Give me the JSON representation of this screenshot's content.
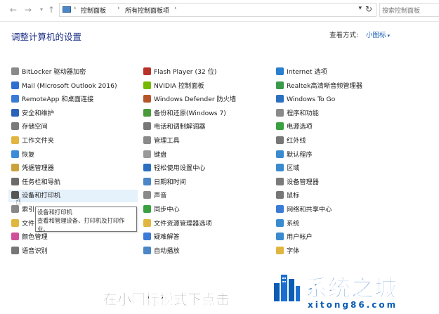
{
  "address_bar": {
    "breadcrumbs": [
      "控制面板",
      "所有控制面板项"
    ],
    "search_placeholder": "搜索控制面板"
  },
  "page": {
    "title": "调整计算机的设置",
    "view_by_label": "查看方式:",
    "view_by_value": "小图标"
  },
  "columns": [
    [
      {
        "label": "BitLocker 驱动器加密",
        "icon": "bitlocker-icon",
        "color": "#8a8a8a"
      },
      {
        "label": "Mail (Microsoft Outlook 2016)",
        "icon": "mail-icon",
        "color": "#2f6fd0"
      },
      {
        "label": "RemoteApp 和桌面连接",
        "icon": "remoteapp-icon",
        "color": "#3a7bd5"
      },
      {
        "label": "安全和维护",
        "icon": "flag-icon",
        "color": "#2a63b8"
      },
      {
        "label": "存储空间",
        "icon": "storage-icon",
        "color": "#7a7a7a"
      },
      {
        "label": "工作文件夹",
        "icon": "folder-icon",
        "color": "#e0b640"
      },
      {
        "label": "恢复",
        "icon": "recovery-icon",
        "color": "#3c8ad8"
      },
      {
        "label": "凭据管理器",
        "icon": "credential-icon",
        "color": "#c9a23a"
      },
      {
        "label": "任务栏和导航",
        "icon": "taskbar-icon",
        "color": "#6b6b6b"
      },
      {
        "label": "设备和打印机",
        "icon": "printer-icon",
        "color": "#555555"
      },
      {
        "label": "索引",
        "icon": "indexing-icon",
        "color": "#888888"
      },
      {
        "label": "文件",
        "icon": "file-history-icon",
        "color": "#e0b640"
      },
      {
        "label": "颜色管理",
        "icon": "color-icon",
        "color": "#d04f9a"
      },
      {
        "label": "语音识别",
        "icon": "mic-icon",
        "color": "#777777"
      }
    ],
    [
      {
        "label": "Flash Player (32 位)",
        "icon": "flash-icon",
        "color": "#b8322a"
      },
      {
        "label": "NVIDIA 控制面板",
        "icon": "nvidia-icon",
        "color": "#76b900"
      },
      {
        "label": "Windows Defender 防火墙",
        "icon": "firewall-icon",
        "color": "#b5562a"
      },
      {
        "label": "备份和还原(Windows 7)",
        "icon": "backup-icon",
        "color": "#4a9a3a"
      },
      {
        "label": "电话和调制解调器",
        "icon": "phone-icon",
        "color": "#777777"
      },
      {
        "label": "管理工具",
        "icon": "admin-tools-icon",
        "color": "#8a8a8a"
      },
      {
        "label": "键盘",
        "icon": "keyboard-icon",
        "color": "#9a9a9a"
      },
      {
        "label": "轻松使用设置中心",
        "icon": "ease-of-access-icon",
        "color": "#2a6fc0"
      },
      {
        "label": "日期和时间",
        "icon": "clock-icon",
        "color": "#4a86c8"
      },
      {
        "label": "声音",
        "icon": "speaker-icon",
        "color": "#8a8a8a"
      },
      {
        "label": "同步中心",
        "icon": "sync-icon",
        "color": "#3aa040"
      },
      {
        "label": "文件资源管理器选项",
        "icon": "explorer-options-icon",
        "color": "#e0b640"
      },
      {
        "label": "疑难解答",
        "icon": "troubleshoot-icon",
        "color": "#3a7bd5"
      },
      {
        "label": "自动播放",
        "icon": "autoplay-icon",
        "color": "#4a86c8"
      }
    ],
    [
      {
        "label": "Internet 选项",
        "icon": "internet-icon",
        "color": "#2a7fd0"
      },
      {
        "label": "Realtek高清晰音频管理器",
        "icon": "realtek-icon",
        "color": "#3a9a4a"
      },
      {
        "label": "Windows To Go",
        "icon": "windows-to-go-icon",
        "color": "#2a6fc0"
      },
      {
        "label": "程序和功能",
        "icon": "programs-icon",
        "color": "#8a8a8a"
      },
      {
        "label": "电源选项",
        "icon": "power-icon",
        "color": "#3aa040"
      },
      {
        "label": "红外线",
        "icon": "infrared-icon",
        "color": "#777777"
      },
      {
        "label": "默认程序",
        "icon": "default-programs-icon",
        "color": "#3a8ad0"
      },
      {
        "label": "区域",
        "icon": "region-icon",
        "color": "#3a8ad0"
      },
      {
        "label": "设备管理器",
        "icon": "device-manager-icon",
        "color": "#7a7a7a"
      },
      {
        "label": "鼠标",
        "icon": "mouse-icon",
        "color": "#777777"
      },
      {
        "label": "网络和共享中心",
        "icon": "network-icon",
        "color": "#3a7bd5"
      },
      {
        "label": "系统",
        "icon": "system-icon",
        "color": "#3a8ad0"
      },
      {
        "label": "用户帐户",
        "icon": "user-accounts-icon",
        "color": "#3a8ad0"
      },
      {
        "label": "字体",
        "icon": "fonts-icon",
        "color": "#e0b640"
      }
    ]
  ],
  "tooltip": {
    "line1": "设备和打印机",
    "line2": "查看和管理设备、打印机及打印作业。"
  },
  "overlay": {
    "subtitle": "在小图标模式下点击",
    "logo_name": "系统之城",
    "logo_url": "xitong86.com",
    "brand_color": "#0b5cb5"
  }
}
